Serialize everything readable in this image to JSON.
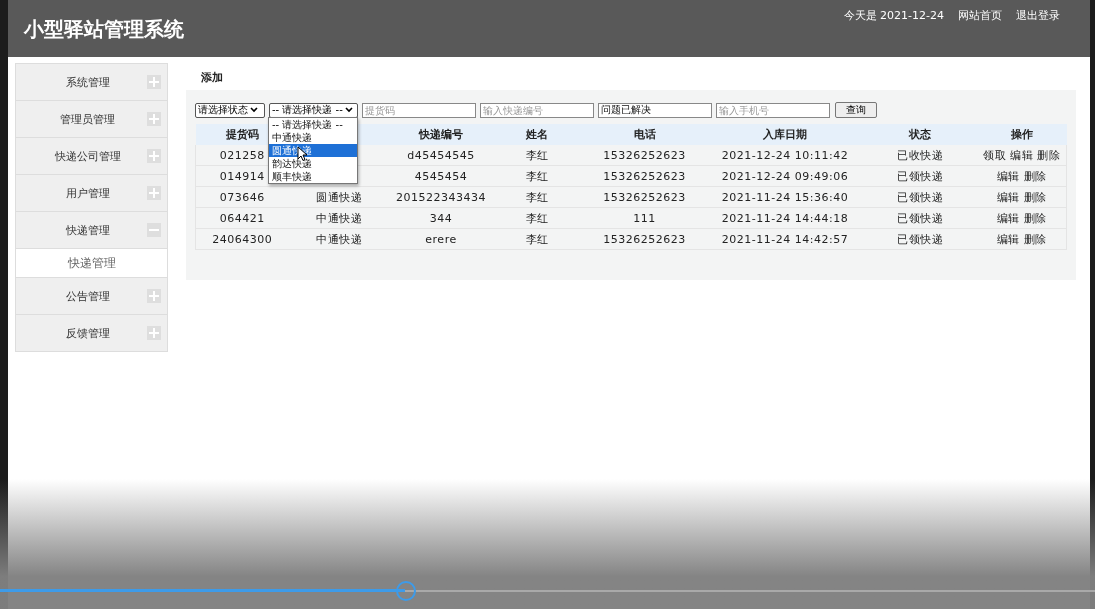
{
  "header": {
    "title": "小型驿站管理系统",
    "date": "今天是 2021-12-24",
    "links": [
      "网站首页",
      "退出登录"
    ]
  },
  "sidebar": {
    "items": [
      {
        "label": "系统管理",
        "expanded": false
      },
      {
        "label": "管理员管理",
        "expanded": false
      },
      {
        "label": "快递公司管理",
        "expanded": false
      },
      {
        "label": "用户管理",
        "expanded": false
      },
      {
        "label": "快递管理",
        "expanded": true,
        "children": [
          {
            "label": "快递管理"
          }
        ]
      },
      {
        "label": "公告管理",
        "expanded": false
      },
      {
        "label": "反馈管理",
        "expanded": false
      }
    ]
  },
  "add_link": "添加",
  "filters": {
    "status_select": "请选择状态",
    "company_select": "-- 请选择快递 --",
    "pickup_code": {
      "placeholder": "提货码"
    },
    "tracking_no": {
      "placeholder": "输入快递编号"
    },
    "issue": {
      "value": "问题已解决"
    },
    "phone": {
      "placeholder": "输入手机号"
    },
    "search_button": "查询"
  },
  "company_dropdown": {
    "options": [
      {
        "label": "-- 请选择快递 --",
        "selected": false
      },
      {
        "label": "中通快递",
        "selected": false
      },
      {
        "label": "圆通快递",
        "selected": true
      },
      {
        "label": "韵达快递",
        "selected": false
      },
      {
        "label": "顺丰快递",
        "selected": false
      }
    ]
  },
  "table": {
    "columns": [
      {
        "label": "提货码"
      },
      {},
      {
        "label": "快递编号"
      },
      {
        "label": "姓名"
      },
      {
        "label": "电话"
      },
      {
        "label": "入库日期"
      },
      {
        "label": "状态"
      },
      {
        "label": "操作"
      }
    ],
    "rows": [
      {
        "code": "021258",
        "tracking": "d45454545",
        "name": "李红",
        "phone": "15326252623",
        "date": "2021-12-24 10:11:42",
        "status": "已收快递",
        "actions": [
          "领取",
          "编辑",
          "删除"
        ]
      },
      {
        "code": "014914",
        "tracking": "4545454",
        "name": "李红",
        "phone": "15326252623",
        "date": "2021-12-24 09:49:06",
        "status": "已领快递",
        "actions": [
          "编辑",
          "删除"
        ]
      },
      {
        "code": "073646",
        "company": "圆通快递",
        "tracking": "201522343434",
        "name": "李红",
        "phone": "15326252623",
        "date": "2021-11-24 15:36:40",
        "status": "已领快递",
        "actions": [
          "编辑",
          "删除"
        ]
      },
      {
        "code": "064421",
        "company": "中通快递",
        "tracking": "344",
        "name": "李红",
        "phone": "111",
        "date": "2021-11-24 14:44:18",
        "status": "已领快递",
        "actions": [
          "编辑",
          "删除"
        ]
      },
      {
        "code": "24064300",
        "company": "中通快递",
        "tracking": "erere",
        "name": "李红",
        "phone": "15326252623",
        "date": "2021-11-24 14:42:57",
        "status": "已领快递",
        "actions": [
          "编辑",
          "删除"
        ]
      }
    ]
  },
  "video_player": {
    "seek": {
      "level": 0.37
    }
  }
}
